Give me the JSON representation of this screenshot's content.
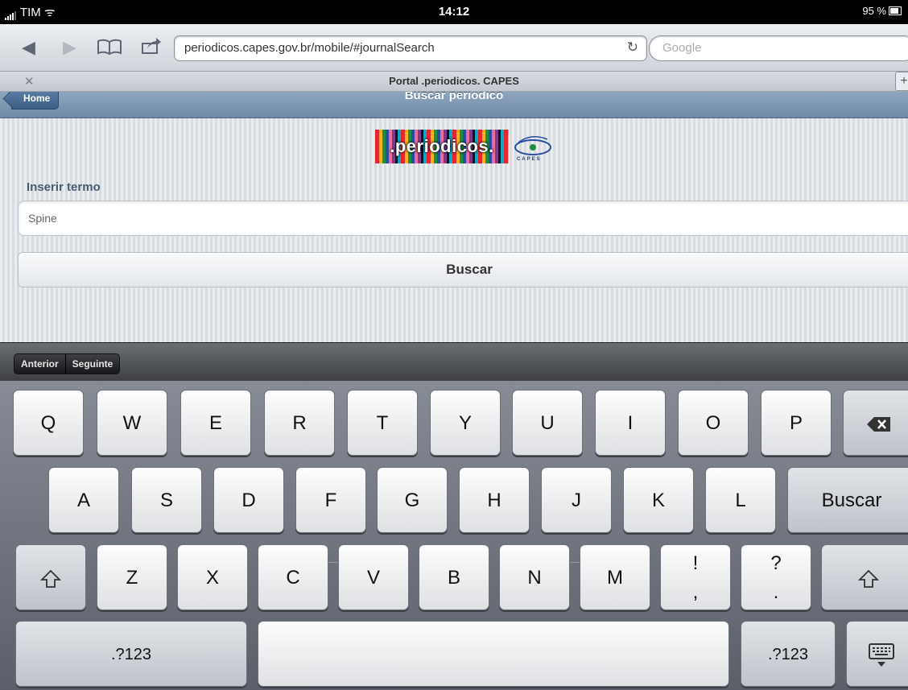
{
  "status_bar": {
    "carrier": "TIM",
    "time": "14:12",
    "battery": "95 %"
  },
  "toolbar": {
    "url": "periodicos.capes.gov.br/mobile/#journalSearch",
    "search_placeholder": "Google"
  },
  "tab": {
    "title": "Portal .periodicos. CAPES"
  },
  "page": {
    "header_title": "Buscar periódico",
    "home_label": "Home",
    "logo_text": ".periodicos.",
    "logo_sub": "CAPES",
    "field_label": "Inserir termo",
    "field_value": "Spine",
    "search_button": "Buscar"
  },
  "accessory": {
    "prev": "Anterior",
    "next": "Seguinte"
  },
  "keyboard": {
    "row1": [
      "Q",
      "W",
      "E",
      "R",
      "T",
      "Y",
      "U",
      "I",
      "O",
      "P"
    ],
    "row2": [
      "A",
      "S",
      "D",
      "F",
      "G",
      "H",
      "J",
      "K",
      "L"
    ],
    "return_label": "Buscar",
    "row3": [
      "Z",
      "X",
      "C",
      "V",
      "B",
      "N",
      "M"
    ],
    "punct1": [
      "!",
      ","
    ],
    "punct2": [
      "?",
      "."
    ],
    "numbers_label": ".?123"
  }
}
